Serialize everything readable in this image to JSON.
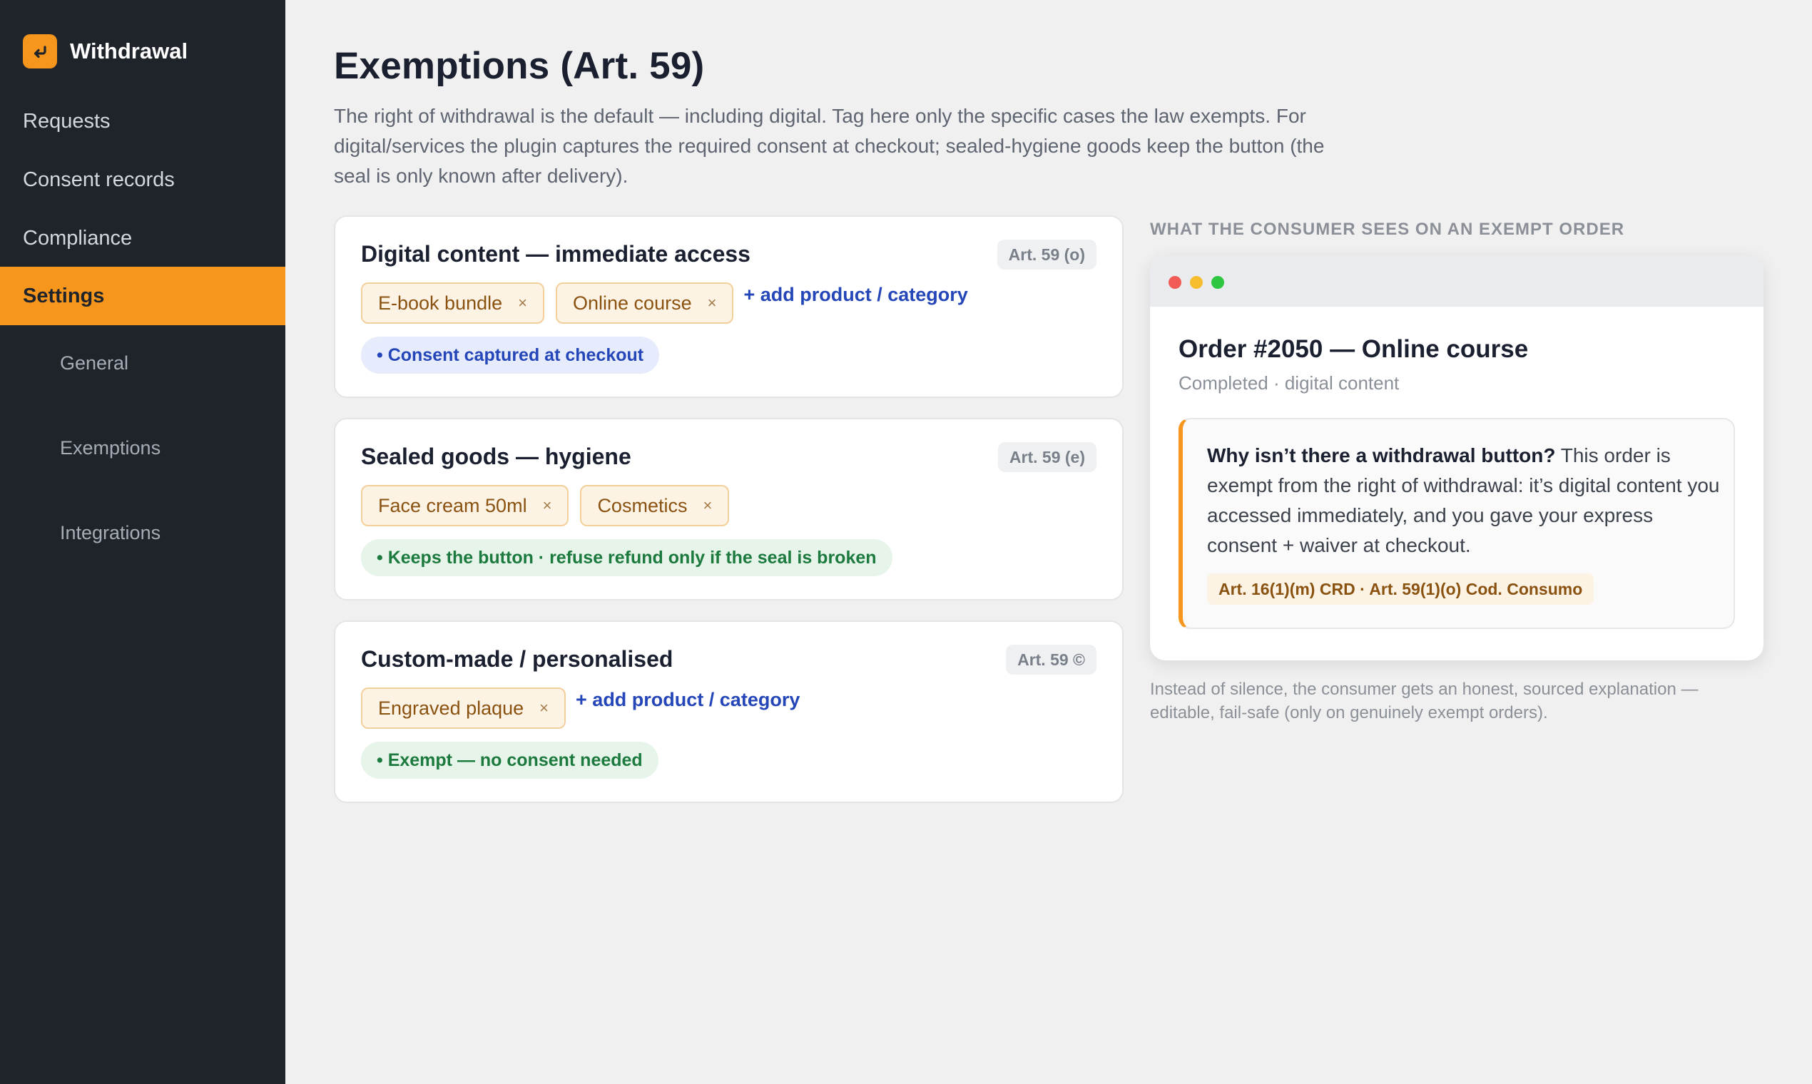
{
  "brand": {
    "name": "Withdrawal",
    "icon": "return-arrow-icon",
    "color": "#f7961d"
  },
  "nav": {
    "items": [
      {
        "label": "Requests"
      },
      {
        "label": "Consent records"
      },
      {
        "label": "Compliance"
      },
      {
        "label": "Settings",
        "active": true
      }
    ],
    "sub_items": [
      {
        "label": "General"
      },
      {
        "label": "Exemptions"
      },
      {
        "label": "Integrations"
      }
    ]
  },
  "page": {
    "title": "Exemptions (Art. 59)",
    "description": "The right of withdrawal is the default — including digital. Tag here only the specific cases the law exempts. For digital/services the plugin captures the required consent at checkout; sealed-hygiene goods keep the button (the seal is only known after delivery)."
  },
  "cards": [
    {
      "title": "Digital content — immediate access",
      "badge": "Art. 59 (o)",
      "tags": [
        "E-book bundle",
        "Online course"
      ],
      "add_label": "+ add product / category",
      "status": "• Consent captured at checkout",
      "status_color": "#2446b8"
    },
    {
      "title": "Sealed goods — hygiene",
      "badge": "Art. 59 (e)",
      "tags": [
        "Face cream 50ml",
        "Cosmetics"
      ],
      "status": "• Keeps the button · refuse refund only if the seal is broken",
      "status_color": "#1d7a3e"
    },
    {
      "title": "Custom-made / personalised",
      "badge": "Art. 59 ©",
      "tags": [
        "Engraved plaque"
      ],
      "add_label": "+ add product / category",
      "status": "• Exempt — no consent needed",
      "status_color": "#1d7a3e"
    }
  ],
  "tag_remove": "×",
  "preview": {
    "label": "WHAT THE CONSUMER SEES ON AN EXEMPT ORDER",
    "window_dots": [
      "#f25b55",
      "#f6bd2e",
      "#2ec640"
    ],
    "order_title": "Order #2050 — Online course",
    "order_sub": "Completed · digital content",
    "notice_bold": "Why isn’t there a withdrawal button?",
    "notice_text": " This order is exempt from the right of withdrawal: it’s digital content you accessed immediately, and you gave your express consent + waiver at checkout.",
    "law_ref": "Art. 16(1)(m) CRD · Art. 59(1)(o) Cod. Consumo",
    "caption": "Instead of silence, the consumer gets an honest, sourced explanation — editable, fail-safe (only on genuinely exempt orders)."
  }
}
